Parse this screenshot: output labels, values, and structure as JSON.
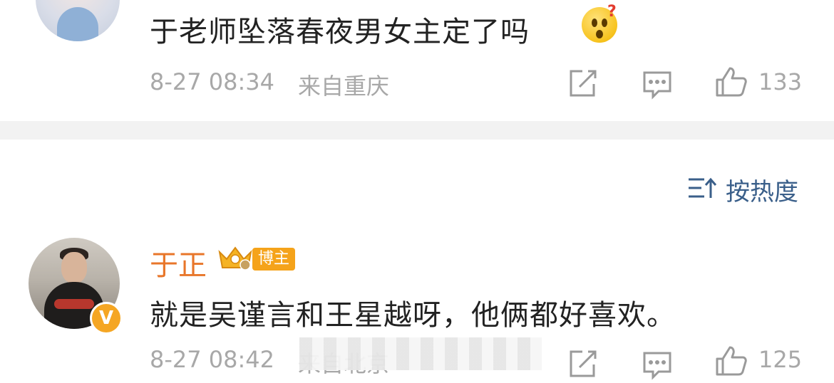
{
  "comment1": {
    "text": "于老师坠落春夜男女主定了吗",
    "emoji": "surprised-face-question",
    "time": "8-27 08:34",
    "location": "来自重庆",
    "likes": "133"
  },
  "sort": {
    "label": "按热度"
  },
  "comment2": {
    "username": "于正",
    "badge": "博主",
    "verified_badge": "V",
    "text": "就是吴谨言和王星越呀，他俩都好喜欢。",
    "time": "8-27 08:42",
    "location": "来自北京",
    "likes": "125"
  },
  "colors": {
    "username": "#e8762a",
    "badge_bg": "#f5a31a",
    "sort_link": "#3a5f8a",
    "meta": "#a8a8a8"
  }
}
